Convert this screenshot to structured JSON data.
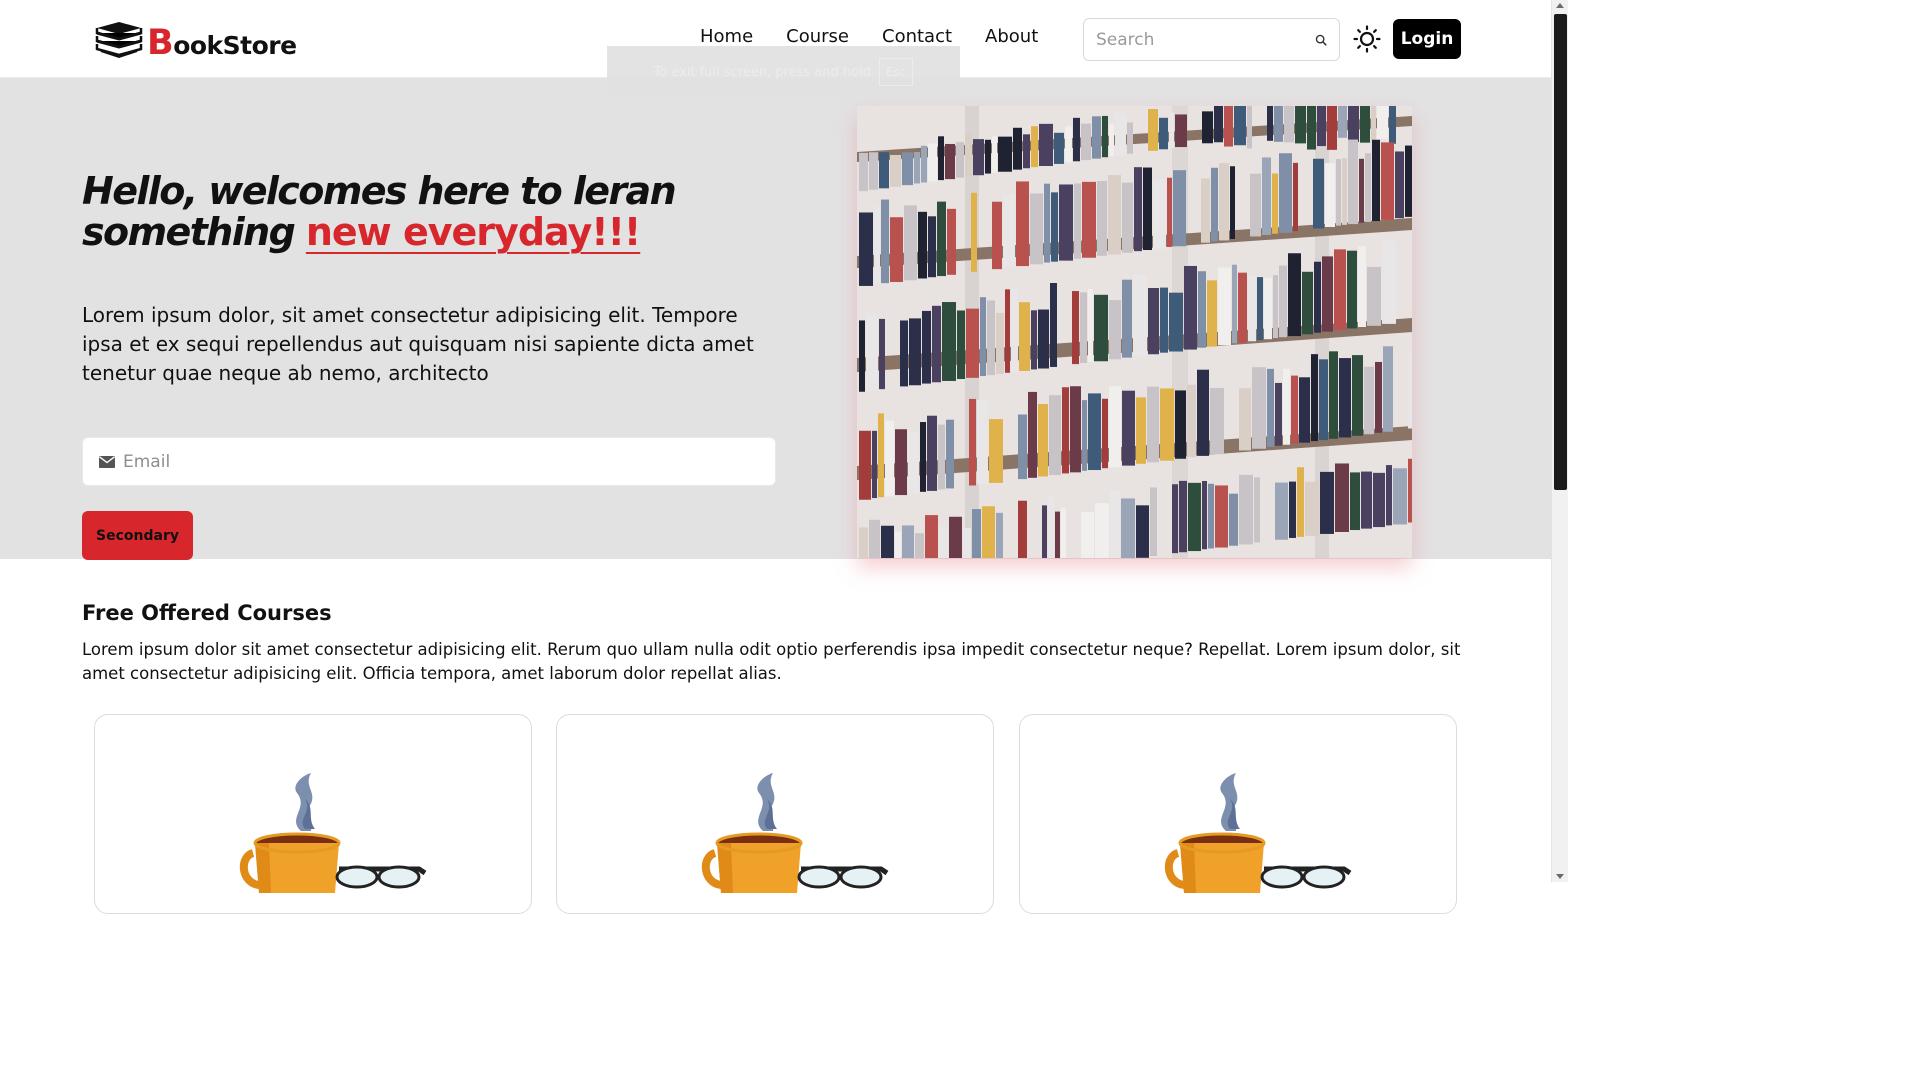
{
  "brand": {
    "logo_letter": "B",
    "logo_rest": "ookStore"
  },
  "nav": {
    "items": [
      "Home",
      "Course",
      "Contact",
      "About"
    ],
    "search_placeholder": "Search",
    "login_label": "Login"
  },
  "fullscreen_toast": {
    "text": "To exit full screen, press and hold",
    "key": "Esc"
  },
  "hero": {
    "title_part1": "Hello, welcomes here to leran something ",
    "title_highlight": "new everyday!!!",
    "description": "Lorem ipsum dolor, sit amet consectetur adipisicing elit. Tempore ipsa et ex sequi repellendus aut quisquam nisi sapiente dicta amet tenetur quae neque ab nemo, architecto",
    "email_placeholder": "Email",
    "button_label": "Secondary"
  },
  "courses": {
    "title": "Free Offered Courses",
    "description": "Lorem ipsum dolor sit amet consectetur adipisicing elit. Rerum quo ullam nulla odit optio perferendis ipsa impedit consectetur neque? Repellat. Lorem ipsum dolor, sit amet consectetur adipisicing elit. Officia tempora, amet laborum dolor repellat alias."
  },
  "colors": {
    "accent": "#d7262c",
    "hero_bg": "#e3e2e3",
    "login_bg": "#000000"
  },
  "icons": [
    "books-logo-icon",
    "search-icon",
    "sun-icon",
    "mail-icon",
    "coffee-glasses-illustration"
  ]
}
